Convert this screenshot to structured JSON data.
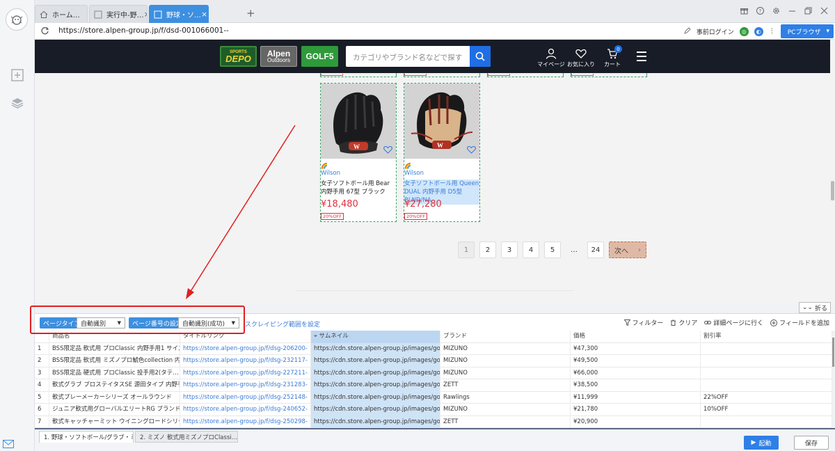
{
  "tabs": [
    {
      "label": "ホーム…"
    },
    {
      "label": "実行中-野…"
    },
    {
      "label": "野球・ソ…"
    }
  ],
  "address": {
    "url": "https://store.alpen-group.jp/f/dsd-001066001--",
    "login": "事前ログイン",
    "pc_browser": "PCブラウザ"
  },
  "site": {
    "brands": {
      "depo_top": "SPORTS",
      "depo": "DEPO",
      "alpen": "Alpen",
      "alpen_sub": "Outdoors",
      "golf": "GOLF5"
    },
    "search_placeholder": "カテゴリやブランド名などで探す",
    "header_icons": {
      "mypage": "マイページ",
      "favorites": "お気に入り",
      "cart": "カート",
      "cart_count": "0"
    },
    "products": [
      {
        "brand": "Wilson",
        "name": "女子ソフトボール用 Bear 内野手用 67型 ブラック",
        "price": "¥18,480",
        "discount": "20%OFF",
        "highlighted": false
      },
      {
        "brand": "Wilson",
        "name": "女子ソフトボール用 Queen DUAL 内野手用 D5型 BLND/NA",
        "price": "¥27,280",
        "discount": "20%OFF",
        "highlighted": true
      }
    ],
    "pager": {
      "pages": [
        "1",
        "2",
        "3",
        "4",
        "5",
        "…",
        "24"
      ],
      "next": "次へ"
    }
  },
  "collapse_label": "折る",
  "config": {
    "page_type_label": "ページタイプ",
    "page_type_value": "自動識別",
    "page_number_label": "ページ番号の設定",
    "page_number_value": "自動識別(成功)",
    "scrape_range_link": "スクレイピング範囲を設定",
    "tools": {
      "filter": "フィルター",
      "clear": "クリア",
      "detail": "詳細ページに行く",
      "add_field": "フィールドを追加"
    }
  },
  "table": {
    "headers": [
      "",
      "商品名",
      "タイトルリンク",
      "サムネイル",
      "ブランド",
      "価格",
      "割引率"
    ],
    "rows": [
      [
        "1",
        "BSS限定品 軟式用 プロClassic 内野手用1 サイズ9",
        "https://store.alpen-group.jp/f/dsg-206200-",
        "https://cdn.store.alpen-group.jp/images/goods/8000…",
        "MIZUNO",
        "¥47,300",
        ""
      ],
      [
        "2",
        "BSS限定品 軟式用 ミズノプロ鯱色collection 内野…",
        "https://store.alpen-group.jp/f/dsg-232117-",
        "https://cdn.store.alpen-group.jp/images/goods/8000…",
        "MIZUNO",
        "¥49,500",
        ""
      ],
      [
        "3",
        "BSS限定品 硬式用 プロClassic 投手用2(タテ…",
        "https://store.alpen-group.jp/f/dsg-227211-",
        "https://cdn.store.alpen-group.jp/images/goods/8020…",
        "MIZUNO",
        "¥66,000",
        ""
      ],
      [
        "4",
        "軟式グラブ プロステイタスSE 源田タイプ 内野手用",
        "https://store.alpen-group.jp/f/dsg-231283-",
        "https://cdn.store.alpen-group.jp/images/goods/8000…",
        "ZETT",
        "¥38,500",
        ""
      ],
      [
        "5",
        "軟式プレーメーカーシリーズ オールラウンド",
        "https://store.alpen-group.jp/f/dsg-252148-",
        "https://cdn.store.alpen-group.jp/images/goods/8000…",
        "Rawlings",
        "¥11,999",
        "22%OFF"
      ],
      [
        "6",
        "ジュニア軟式用グローバルエリートRG ブランドア…",
        "https://store.alpen-group.jp/f/dsg-240652-",
        "https://cdn.store.alpen-group.jp/images/goods/8004…",
        "MIZUNO",
        "¥21,780",
        "10%OFF"
      ],
      [
        "7",
        "軟式キャッチャーミット ウイニングロードシリー…",
        "https://store.alpen-group.jp/f/dsg-250298-",
        "https://cdn.store.alpen-group.jp/images/goods/8002…",
        "ZETT",
        "¥20,900",
        ""
      ]
    ]
  },
  "bottom": {
    "tasks": [
      "1. 野球・ソフトボール/グラブ・ミ…",
      "2. ミズノ 軟式用ミズノプロClassi…"
    ],
    "run": "起動",
    "save": "保存"
  }
}
